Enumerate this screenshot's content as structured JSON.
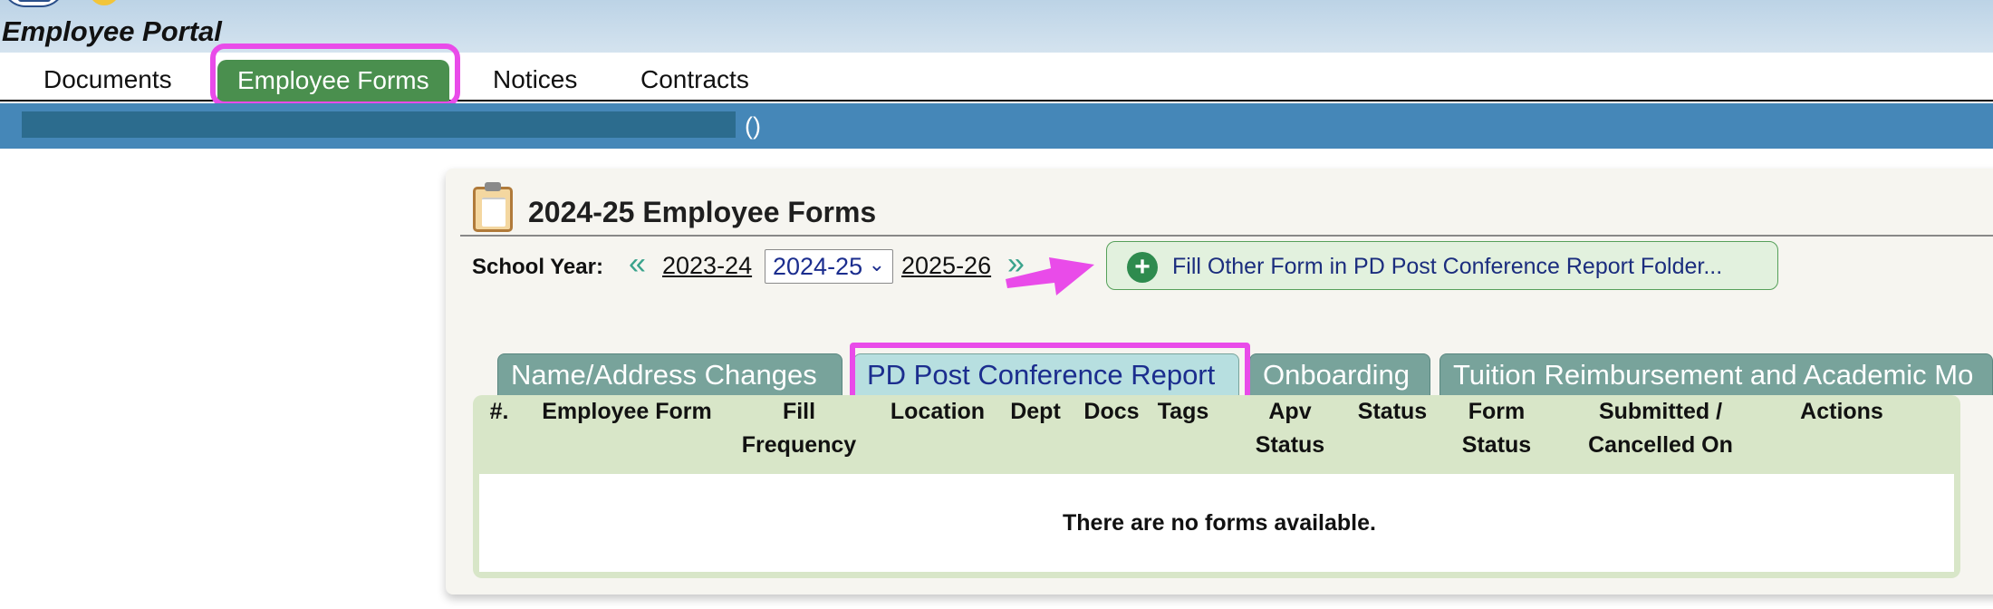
{
  "header": {
    "title": "Employee Portal"
  },
  "nav": {
    "tabs": [
      {
        "label": "Documents"
      },
      {
        "label": "Employee Forms"
      },
      {
        "label": "Notices"
      },
      {
        "label": "Contracts"
      }
    ],
    "active_tab": "Employee Forms",
    "active_color": "#4a8f4e"
  },
  "bluebar": {
    "suffix": "()",
    "color": "#4587b8"
  },
  "panel": {
    "icon": "clipboard-icon",
    "title": "2024-25 Employee Forms",
    "school_year_label": "School Year:",
    "prev_year": "2023-24",
    "selected_year": "2024-25",
    "next_year": "2025-26",
    "prev_icon": "double-chevron-left-icon",
    "next_icon": "double-chevron-right-icon",
    "fill_button": {
      "label": "Fill Other Form in PD Post Conference Report Folder...",
      "icon": "plus-circle-icon"
    }
  },
  "folder_tabs": [
    {
      "label": "Name/Address Changes"
    },
    {
      "label": "PD Post Conference Report"
    },
    {
      "label": "Onboarding"
    },
    {
      "label": "Tuition Reimbursement and Academic Mo"
    }
  ],
  "active_folder_tab": "PD Post Conference Report",
  "table": {
    "columns": [
      {
        "line1": "",
        "line2": "#."
      },
      {
        "line1": "",
        "line2": "Employee Form"
      },
      {
        "line1": "Fill",
        "line2": "Frequency"
      },
      {
        "line1": "",
        "line2": "Location"
      },
      {
        "line1": "",
        "line2": "Dept"
      },
      {
        "line1": "",
        "line2": "Docs"
      },
      {
        "line1": "",
        "line2": "Tags"
      },
      {
        "line1": "Apv",
        "line2": "Status"
      },
      {
        "line1": "",
        "line2": "Status"
      },
      {
        "line1": "Form",
        "line2": "Status"
      },
      {
        "line1": "Submitted /",
        "line2": "Cancelled On"
      },
      {
        "line1": "",
        "line2": "Actions"
      }
    ],
    "empty_message": "There are no forms available."
  },
  "annotations": {
    "highlight_color": "#e94be9"
  }
}
